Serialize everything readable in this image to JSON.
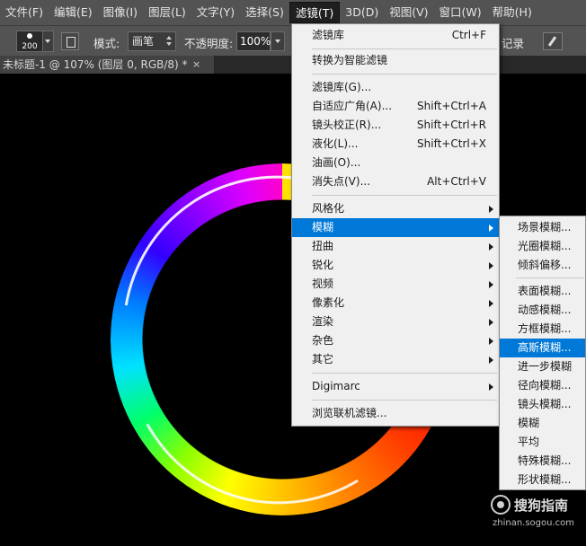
{
  "menubar": {
    "items": [
      "文件(F)",
      "编辑(E)",
      "图像(I)",
      "图层(L)",
      "文字(Y)",
      "选择(S)",
      "滤镜(T)",
      "3D(D)",
      "视图(V)",
      "窗口(W)",
      "帮助(H)"
    ]
  },
  "options": {
    "brush_size": "200",
    "mode_label": "模式:",
    "mode_value": "画笔",
    "opacity_label": "不透明度:",
    "opacity_value": "100%",
    "history_label": "记录"
  },
  "document": {
    "tab_title": "未标题-1 @ 107% (图层 0, RGB/8) *",
    "close_glyph": "×"
  },
  "filter_menu": {
    "items": [
      {
        "label": "滤镜库",
        "shortcut": "Ctrl+F"
      },
      {
        "label": "转换为智能滤镜",
        "shortcut": ""
      },
      {
        "label": "滤镜库(G)...",
        "shortcut": ""
      },
      {
        "label": "自适应广角(A)...",
        "shortcut": "Shift+Ctrl+A"
      },
      {
        "label": "镜头校正(R)...",
        "shortcut": "Shift+Ctrl+R"
      },
      {
        "label": "液化(L)...",
        "shortcut": "Shift+Ctrl+X"
      },
      {
        "label": "油画(O)...",
        "shortcut": ""
      },
      {
        "label": "消失点(V)...",
        "shortcut": "Alt+Ctrl+V"
      },
      {
        "label": "风格化",
        "shortcut": ""
      },
      {
        "label": "模糊",
        "shortcut": ""
      },
      {
        "label": "扭曲",
        "shortcut": ""
      },
      {
        "label": "锐化",
        "shortcut": ""
      },
      {
        "label": "视频",
        "shortcut": ""
      },
      {
        "label": "像素化",
        "shortcut": ""
      },
      {
        "label": "渲染",
        "shortcut": ""
      },
      {
        "label": "杂色",
        "shortcut": ""
      },
      {
        "label": "其它",
        "shortcut": ""
      },
      {
        "label": "Digimarc",
        "shortcut": ""
      },
      {
        "label": "浏览联机滤镜...",
        "shortcut": ""
      }
    ]
  },
  "blur_submenu": {
    "items": [
      "场景模糊...",
      "光圈模糊...",
      "倾斜偏移...",
      "表面模糊...",
      "动感模糊...",
      "方框模糊...",
      "高斯模糊...",
      "进一步模糊",
      "径向模糊...",
      "镜头模糊...",
      "模糊",
      "平均",
      "特殊模糊...",
      "形状模糊..."
    ]
  },
  "watermark": {
    "name": "搜狗指南",
    "url": "zhinan.sogou.com"
  },
  "colors": {
    "menu_highlight": "#0078d7",
    "menubar_bg": "#535353",
    "menu_bg": "#f0f0f0"
  }
}
